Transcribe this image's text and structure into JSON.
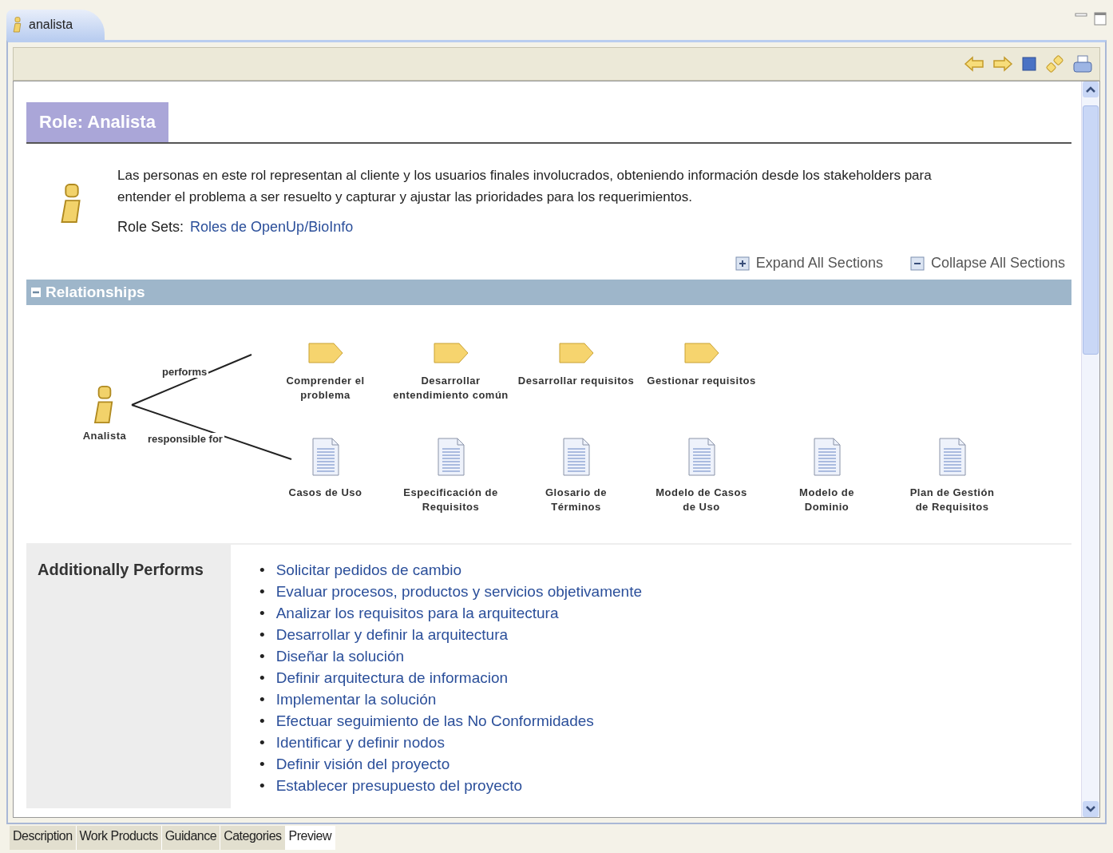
{
  "editor_tab": {
    "label": "analista",
    "selected": true
  },
  "page": {
    "title": "Role: Analista",
    "description": "Las personas en este rol representan al cliente y los usuarios finales involucrados, obteniendo información desde los stakeholders para entender el problema a ser resuelto y capturar y ajustar las prioridades para los requerimientos.",
    "role_sets_label": "Role Sets:",
    "role_sets_link": "Roles de OpenUp/BioInfo",
    "expand_all": "Expand All Sections",
    "collapse_all": "Collapse All Sections"
  },
  "relationships": {
    "title": "Relationships",
    "expanded": true,
    "role": "Analista",
    "performs_label": "performs",
    "responsible_label": "responsible for",
    "tasks": [
      "Comprender el problema",
      "Desarrollar entendimiento común",
      "Desarrollar requisitos",
      "Gestionar requisitos"
    ],
    "work_products": [
      "Casos de Uso",
      "Especificación de Requisitos",
      "Glosario de Términos",
      "Modelo de Casos de Uso",
      "Modelo de Dominio",
      "Plan de Gestión de Requisitos"
    ]
  },
  "additionally_performs": {
    "title": "Additionally Performs",
    "items": [
      {
        "bullet": "•",
        "text": "Solicitar pedidos de cambio"
      },
      {
        "bullet": "•",
        "text": "Evaluar procesos, productos y servicios objetivamente"
      },
      {
        "bullet": "•",
        "text": "Analizar los requisitos para la arquitectura"
      },
      {
        "bullet": "•",
        "text": "Desarrollar y definir la arquitectura"
      },
      {
        "bullet": "•",
        "text": "Diseñar la solución"
      },
      {
        "bullet": "•",
        "text": "Definir arquitectura de informacion"
      },
      {
        "bullet": "•",
        "text": "Implementar la solución"
      },
      {
        "bullet": "•",
        "text": "Efectuar seguimiento de las No Conformidades"
      },
      {
        "bullet": "•",
        "text": "Identificar y definir nodos"
      },
      {
        "bullet": "•",
        "text": "Definir visión del proyecto"
      },
      {
        "bullet": "•",
        "text": "Establecer presupuesto del proyecto"
      }
    ]
  },
  "bottom_tabs": [
    {
      "label": "Description",
      "selected": false
    },
    {
      "label": "Work Products",
      "selected": false
    },
    {
      "label": "Guidance",
      "selected": false
    },
    {
      "label": "Categories",
      "selected": false
    },
    {
      "label": "Preview",
      "selected": true
    }
  ]
}
